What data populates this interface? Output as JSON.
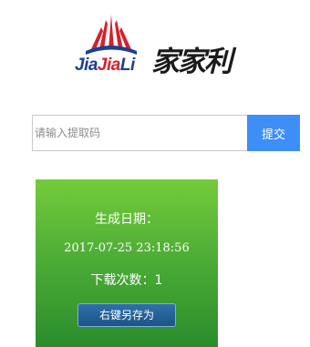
{
  "logo": {
    "latin_parts": [
      "Jia",
      "Jia",
      "Li"
    ],
    "chinese": "家家利",
    "colors": {
      "blue": "#1b3f95",
      "red": "#d6202c",
      "dark": "#1a1a1a"
    }
  },
  "search": {
    "placeholder": "请输入提取码",
    "value": "",
    "submit_label": "提交",
    "submit_color": "#3e8ef7"
  },
  "card": {
    "date_label": "生成日期：",
    "date_value": "2017-07-25 23:18:56",
    "download_label": "下载次数：",
    "download_count": "1",
    "save_button_label": "右键另存为",
    "background_top": "#74cb3b",
    "background_bottom": "#2a8d2c"
  }
}
